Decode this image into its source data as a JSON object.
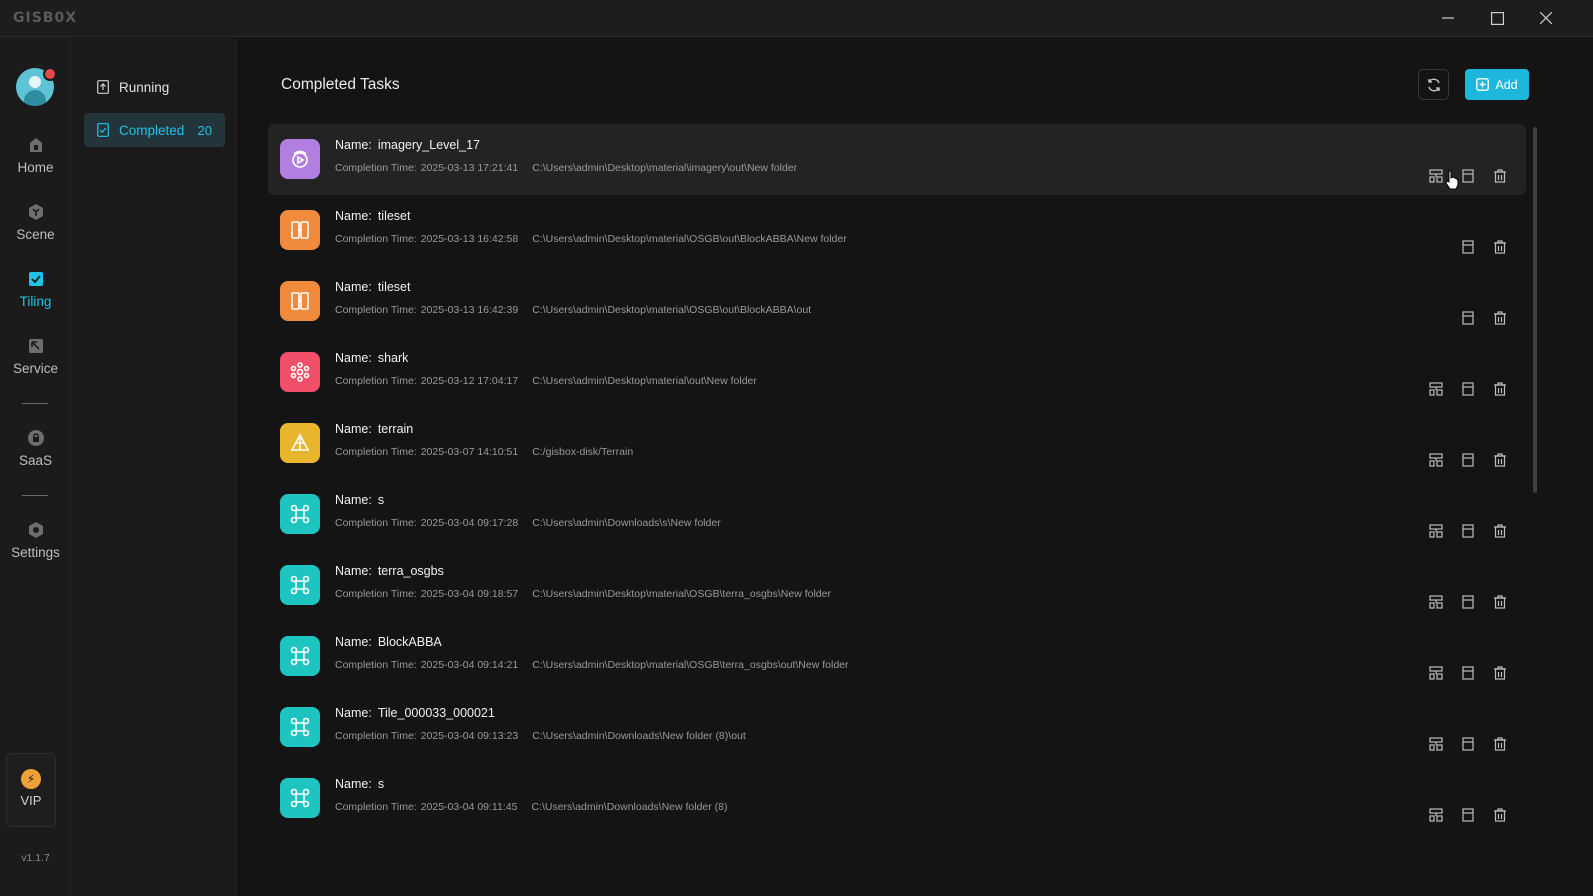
{
  "app": {
    "logo_text": "GISB0X",
    "version": "v1.1.7"
  },
  "nav": {
    "items": [
      {
        "label": "Home",
        "icon": "home-icon",
        "active": false
      },
      {
        "label": "Scene",
        "icon": "scene-icon",
        "active": false
      },
      {
        "label": "Tiling",
        "icon": "tiling-icon",
        "active": true
      },
      {
        "label": "Service",
        "icon": "service-icon",
        "active": false
      },
      {
        "label": "SaaS",
        "icon": "saas-icon",
        "active": false
      },
      {
        "label": "Settings",
        "icon": "settings-icon",
        "active": false
      }
    ],
    "vip_label": "VIP"
  },
  "subnav": {
    "running_label": "Running",
    "completed_label": "Completed",
    "completed_count": "20"
  },
  "main": {
    "title": "Completed Tasks",
    "add_label": "Add",
    "name_label": "Name:",
    "time_label": "Completion Time:"
  },
  "tasks": [
    {
      "name": "imagery_Level_17",
      "time": "2025-03-13 17:21:41",
      "path": "C:\\Users\\admin\\Desktop\\material\\imagery\\out\\New folder",
      "icon": "imagery-icon",
      "color": "#b07fe0",
      "actions": 3
    },
    {
      "name": "tileset",
      "time": "2025-03-13 16:42:58",
      "path": "C:\\Users\\admin\\Desktop\\material\\OSGB\\out\\BlockABBA\\New folder",
      "icon": "tileset-icon",
      "color": "#f08a3c",
      "actions": 2
    },
    {
      "name": "tileset",
      "time": "2025-03-13 16:42:39",
      "path": "C:\\Users\\admin\\Desktop\\material\\OSGB\\out\\BlockABBA\\out",
      "icon": "tileset-icon",
      "color": "#f08a3c",
      "actions": 2
    },
    {
      "name": "shark",
      "time": "2025-03-12 17:04:17",
      "path": "C:\\Users\\admin\\Desktop\\material\\out\\New folder",
      "icon": "model-icon",
      "color": "#f0506a",
      "actions": 3
    },
    {
      "name": "terrain",
      "time": "2025-03-07 14:10:51",
      "path": "C:/gisbox-disk/Terrain",
      "icon": "terrain-icon",
      "color": "#e8b52c",
      "actions": 3
    },
    {
      "name": "s",
      "time": "2025-03-04 09:17:28",
      "path": "C:\\Users\\admin\\Downloads\\s\\New folder",
      "icon": "osgb-icon",
      "color": "#1ec4c0",
      "actions": 3
    },
    {
      "name": "terra_osgbs",
      "time": "2025-03-04 09:18:57",
      "path": "C:\\Users\\admin\\Desktop\\material\\OSGB\\terra_osgbs\\New folder",
      "icon": "osgb-icon",
      "color": "#1ec4c0",
      "actions": 3
    },
    {
      "name": "BlockABBA",
      "time": "2025-03-04 09:14:21",
      "path": "C:\\Users\\admin\\Desktop\\material\\OSGB\\terra_osgbs\\out\\New folder",
      "icon": "osgb-icon",
      "color": "#1ec4c0",
      "actions": 3
    },
    {
      "name": "Tile_000033_000021",
      "time": "2025-03-04 09:13:23",
      "path": "C:\\Users\\admin\\Downloads\\New folder (8)\\out",
      "icon": "osgb-icon",
      "color": "#1ec4c0",
      "actions": 3
    },
    {
      "name": "s",
      "time": "2025-03-04 09:11:45",
      "path": "C:\\Users\\admin\\Downloads\\New folder (8)",
      "icon": "osgb-icon",
      "color": "#1ec4c0",
      "actions": 3
    }
  ]
}
